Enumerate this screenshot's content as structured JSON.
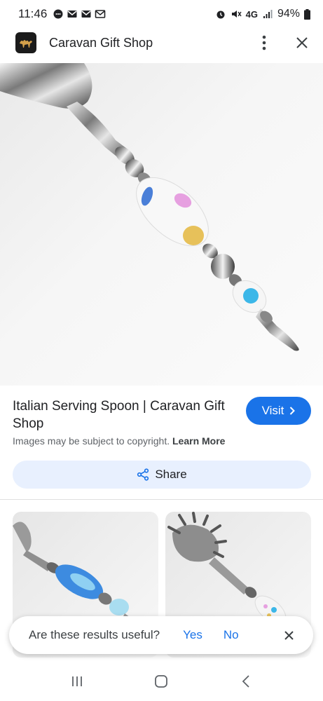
{
  "status_bar": {
    "time": "11:46",
    "network": "4G",
    "battery": "94%"
  },
  "header": {
    "site_title": "Caravan Gift Shop",
    "favicon": "camel-logo-icon",
    "menu_icon": "more-vert-icon",
    "close_icon": "close-icon"
  },
  "result": {
    "title": "Italian Serving Spoon | Caravan Gift Shop",
    "visit_label": "Visit",
    "copyright_text": "Images may be subject to copyright.",
    "learn_more_label": "Learn More",
    "share_label": "Share"
  },
  "feedback": {
    "question": "Are these results useful?",
    "yes_label": "Yes",
    "no_label": "No"
  },
  "colors": {
    "accent": "#1a73e8",
    "share_bg": "#e8f0fe"
  }
}
